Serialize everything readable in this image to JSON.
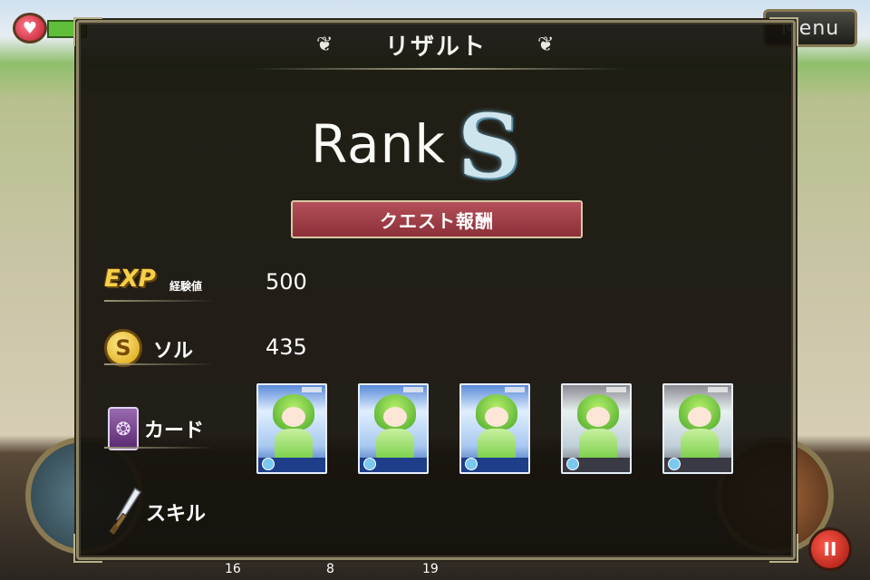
{
  "hud": {
    "menu_label": "Menu",
    "stop_label": "II"
  },
  "bottom_counts": [
    "16",
    "8",
    "19"
  ],
  "result": {
    "title": "リザルト",
    "rank_word": "Rank",
    "rank_letter": "S",
    "reward_label": "クエスト報酬",
    "rows": {
      "exp": {
        "icon_text": "EXP",
        "label": "経験値",
        "value": "500",
        "icon": "exp-badge-icon"
      },
      "sol": {
        "icon_text": "S",
        "label": "ソル",
        "value": "435",
        "icon": "coin-icon"
      },
      "card": {
        "label": "カード",
        "icon": "card-icon"
      },
      "skill": {
        "label": "スキル",
        "icon": "sword-icon"
      }
    },
    "cards": [
      {
        "name": "reward-card-1",
        "frame": "blue"
      },
      {
        "name": "reward-card-2",
        "frame": "blue"
      },
      {
        "name": "reward-card-3",
        "frame": "blue"
      },
      {
        "name": "reward-card-4",
        "frame": "silver"
      },
      {
        "name": "reward-card-5",
        "frame": "silver"
      }
    ]
  },
  "colors": {
    "panel_bg": "#14110c",
    "panel_border": "#8d8566",
    "reward_bar": "#a4424c",
    "rank_s": "#cfe5ee"
  }
}
